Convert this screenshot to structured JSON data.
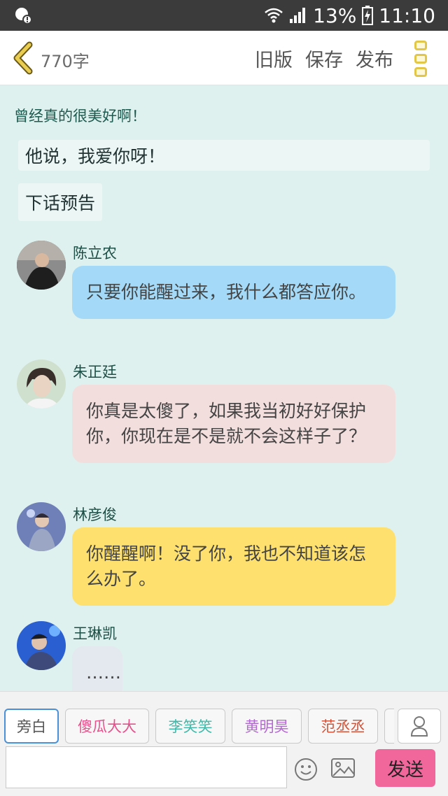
{
  "status_bar": {
    "battery_percent": "13%",
    "time": "11:10"
  },
  "header": {
    "word_count": "770字",
    "old_version_label": "旧版",
    "save_label": "保存",
    "publish_label": "发布"
  },
  "content": {
    "top_text": "曾经真的很美好啊！",
    "narrations": [
      {
        "text": "他说，我爱你呀！"
      },
      {
        "text": "下话预告"
      }
    ],
    "messages": [
      {
        "name": "陈立农",
        "text": "只要你能醒过来，我什么都答应你。",
        "bubble_color": "#a4daf7"
      },
      {
        "name": "朱正廷",
        "text": "你真是太傻了，如果我当初好好保护你，你现在是不是就不会这样子了？",
        "bubble_color": "#f3dede"
      },
      {
        "name": "林彦俊",
        "text": "你醒醒啊！没了你，我也不知道该怎么办了。",
        "bubble_color": "#fde06e"
      },
      {
        "name": "王琳凯",
        "text": "……",
        "bubble_color": "#e3e9ee"
      }
    ]
  },
  "bottom_bar": {
    "characters": [
      {
        "label": "旁白",
        "color": "#555555"
      },
      {
        "label": "傻瓜大大",
        "color": "#e5518a"
      },
      {
        "label": "李笑笑",
        "color": "#3fb8a8"
      },
      {
        "label": "黄明昊",
        "color": "#b36ad0"
      },
      {
        "label": "范丞丞",
        "color": "#d0543a"
      }
    ],
    "message_input_value": "",
    "send_label": "发送"
  },
  "colors": {
    "accent_yellow": "#e2c64a",
    "send_pink": "#f1669b",
    "background": "#dff1ee"
  }
}
